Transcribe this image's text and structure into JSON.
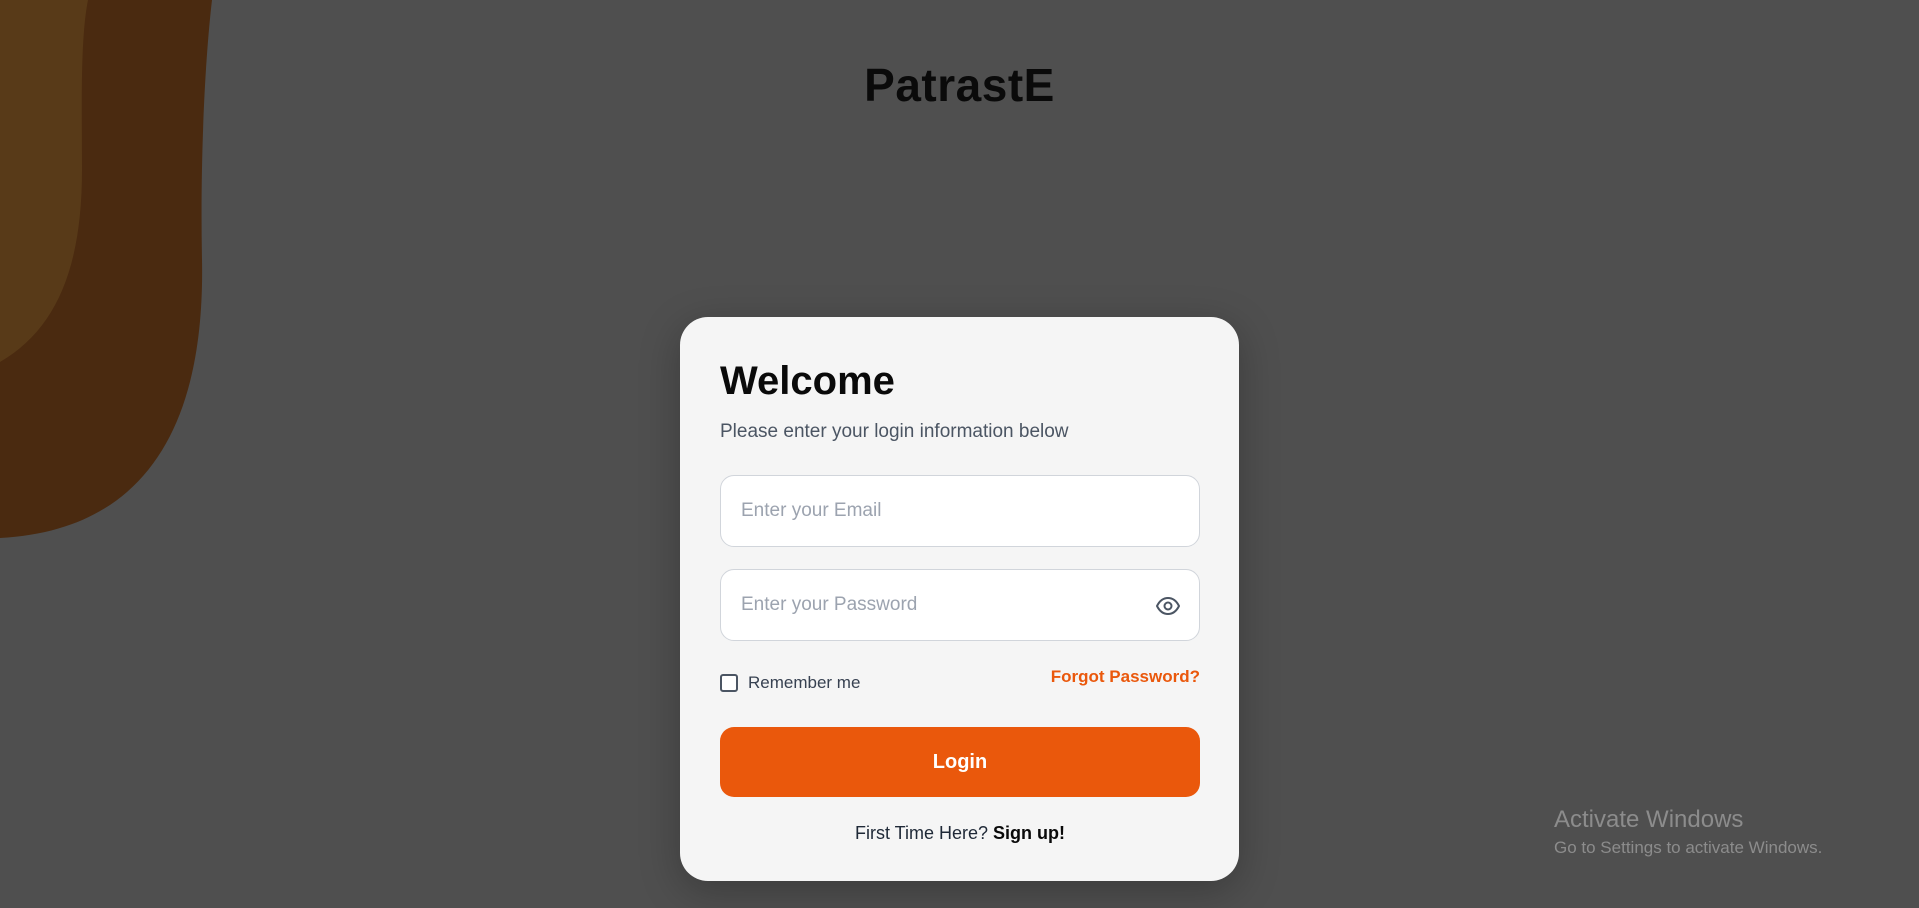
{
  "brand": {
    "name": "PatrastE"
  },
  "login_card": {
    "title": "Welcome",
    "subtitle": "Please enter your login information below",
    "email_placeholder": "Enter your Email",
    "email_value": "",
    "password_placeholder": "Enter your Password",
    "password_value": "",
    "password_toggle_icon": "eye-icon",
    "remember_label": "Remember me",
    "remember_checked": false,
    "forgot_label": "Forgot Password?",
    "login_label": "Login",
    "signup_prompt": "First Time Here?",
    "signup_link": "Sign up!"
  },
  "watermark": {
    "title": "Activate Windows",
    "subtitle": "Go to Settings to activate Windows."
  },
  "colors": {
    "background": "#4f4f4f",
    "accent": "#ea580c",
    "card": "#f5f5f5",
    "decor_dark": "#4a2a10",
    "decor_light": "#5a3a16"
  }
}
